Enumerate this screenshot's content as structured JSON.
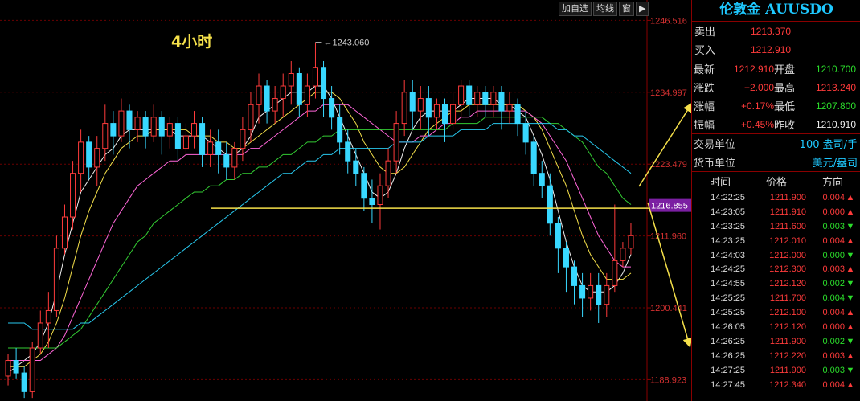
{
  "toolbar": {
    "add_watch": "加自选",
    "ma": "均线",
    "window": "窗",
    "exit_icon": "exit-icon"
  },
  "chart_data": {
    "type": "candlestick",
    "title": "4小时",
    "ylim": [
      1185.5,
      1248.5
    ],
    "y_ticks": [
      "1246.516",
      "1234.997",
      "1223.479",
      "1211.960",
      "1200.441",
      "1188.923"
    ],
    "high_annotation": "1243.060",
    "current_price_label": "1216.855",
    "support_level": 1216.4,
    "grid": "dashed-horizontal",
    "candles": [
      [
        1189.5,
        1192,
        1188,
        1193
      ],
      [
        1192,
        1190,
        1189,
        1194
      ],
      [
        1190,
        1187,
        1186,
        1191
      ],
      [
        1187,
        1194,
        1186,
        1195
      ],
      [
        1194,
        1198,
        1193,
        1200
      ],
      [
        1198,
        1200,
        1194,
        1203
      ],
      [
        1200,
        1210,
        1199,
        1212
      ],
      [
        1210,
        1215,
        1209,
        1217
      ],
      [
        1215,
        1222,
        1213,
        1224
      ],
      [
        1222,
        1227,
        1219,
        1229
      ],
      [
        1227,
        1223,
        1221,
        1228
      ],
      [
        1223,
        1226,
        1220,
        1228
      ],
      [
        1226,
        1230,
        1224,
        1233
      ],
      [
        1230,
        1228,
        1225,
        1232
      ],
      [
        1228,
        1232,
        1227,
        1234
      ],
      [
        1232,
        1229,
        1226,
        1233
      ],
      [
        1229,
        1231,
        1227,
        1232
      ],
      [
        1231,
        1228,
        1226,
        1232
      ],
      [
        1228,
        1231,
        1227,
        1233
      ],
      [
        1231,
        1228,
        1225,
        1232
      ],
      [
        1228,
        1230,
        1226,
        1231
      ],
      [
        1230,
        1226,
        1224,
        1231
      ],
      [
        1226,
        1228,
        1225,
        1230
      ],
      [
        1228,
        1230,
        1226,
        1232
      ],
      [
        1230,
        1225,
        1223,
        1231
      ],
      [
        1225,
        1227,
        1223,
        1229
      ],
      [
        1227,
        1225,
        1222,
        1229
      ],
      [
        1225,
        1223,
        1221,
        1227
      ],
      [
        1223,
        1226,
        1221,
        1227
      ],
      [
        1226,
        1229,
        1224,
        1231
      ],
      [
        1229,
        1233,
        1227,
        1235
      ],
      [
        1233,
        1236,
        1230,
        1238
      ],
      [
        1236,
        1232,
        1230,
        1237
      ],
      [
        1232,
        1234,
        1230,
        1236
      ],
      [
        1234,
        1236,
        1231,
        1238
      ],
      [
        1236,
        1238,
        1233,
        1240
      ],
      [
        1238,
        1233,
        1231,
        1239
      ],
      [
        1233,
        1236,
        1231,
        1238
      ],
      [
        1236,
        1239,
        1234,
        1243
      ],
      [
        1239,
        1234,
        1231,
        1240
      ],
      [
        1234,
        1231,
        1229,
        1236
      ],
      [
        1231,
        1227,
        1225,
        1233
      ],
      [
        1227,
        1224,
        1222,
        1229
      ],
      [
        1224,
        1222,
        1220,
        1226
      ],
      [
        1222,
        1218,
        1216,
        1223
      ],
      [
        1218,
        1217,
        1214,
        1221
      ],
      [
        1217,
        1220,
        1213,
        1222
      ],
      [
        1220,
        1224,
        1218,
        1226
      ],
      [
        1224,
        1230,
        1222,
        1232
      ],
      [
        1230,
        1235,
        1228,
        1237
      ],
      [
        1235,
        1232,
        1229,
        1237
      ],
      [
        1232,
        1234,
        1229,
        1236
      ],
      [
        1234,
        1231,
        1228,
        1236
      ],
      [
        1231,
        1233,
        1229,
        1234
      ],
      [
        1233,
        1230,
        1227,
        1234
      ],
      [
        1230,
        1233,
        1229,
        1235
      ],
      [
        1233,
        1236,
        1231,
        1237
      ],
      [
        1236,
        1233,
        1231,
        1237
      ],
      [
        1233,
        1235,
        1231,
        1236
      ],
      [
        1235,
        1233,
        1231,
        1236
      ],
      [
        1233,
        1235,
        1231,
        1236
      ],
      [
        1235,
        1232,
        1229,
        1236
      ],
      [
        1232,
        1233,
        1230,
        1235
      ],
      [
        1233,
        1230,
        1228,
        1234
      ],
      [
        1230,
        1227,
        1225,
        1232
      ],
      [
        1227,
        1222,
        1220,
        1228
      ],
      [
        1222,
        1220,
        1218,
        1224
      ],
      [
        1220,
        1214,
        1212,
        1222
      ],
      [
        1214,
        1210,
        1206,
        1215
      ],
      [
        1210,
        1207,
        1203,
        1211
      ],
      [
        1207,
        1204,
        1201,
        1208
      ],
      [
        1204,
        1202,
        1199,
        1206
      ],
      [
        1202,
        1204,
        1200,
        1206
      ],
      [
        1204,
        1201,
        1198,
        1206
      ],
      [
        1201,
        1204,
        1199,
        1206
      ],
      [
        1204,
        1208,
        1203,
        1217
      ],
      [
        1208,
        1210,
        1207,
        1211
      ],
      [
        1210,
        1212,
        1209,
        1214
      ]
    ],
    "ma_lines": {
      "ma_white": [
        1190,
        1191,
        1192,
        1193,
        1195,
        1198,
        1203,
        1209,
        1214,
        1219,
        1221,
        1223,
        1225,
        1226,
        1228,
        1229,
        1229,
        1229,
        1229,
        1229,
        1229,
        1228,
        1228,
        1228,
        1228,
        1227,
        1226,
        1225,
        1225,
        1226,
        1228,
        1231,
        1232,
        1233,
        1234,
        1235,
        1235,
        1235,
        1236,
        1236,
        1234,
        1231,
        1228,
        1225,
        1222,
        1219,
        1218,
        1219,
        1222,
        1226,
        1229,
        1231,
        1232,
        1232,
        1232,
        1232,
        1233,
        1234,
        1234,
        1234,
        1234,
        1233,
        1233,
        1232,
        1231,
        1228,
        1225,
        1221,
        1216,
        1211,
        1207,
        1204,
        1203,
        1203,
        1203,
        1204,
        1206,
        1209
      ],
      "ma_yellow": [
        1191,
        1191,
        1191,
        1192,
        1193,
        1195,
        1198,
        1202,
        1207,
        1212,
        1216,
        1219,
        1222,
        1224,
        1226,
        1227,
        1228,
        1228,
        1229,
        1229,
        1229,
        1229,
        1229,
        1228,
        1228,
        1228,
        1227,
        1227,
        1226,
        1226,
        1227,
        1228,
        1229,
        1230,
        1231,
        1232,
        1233,
        1234,
        1235,
        1235,
        1235,
        1234,
        1232,
        1230,
        1227,
        1225,
        1223,
        1222,
        1222,
        1223,
        1225,
        1227,
        1229,
        1230,
        1231,
        1232,
        1232,
        1233,
        1233,
        1233,
        1233,
        1233,
        1233,
        1233,
        1232,
        1231,
        1229,
        1226,
        1223,
        1220,
        1216,
        1212,
        1209,
        1207,
        1205,
        1205,
        1205,
        1206
      ],
      "ma_pink": [
        1192,
        1192,
        1192,
        1192,
        1192,
        1193,
        1194,
        1196,
        1199,
        1202,
        1205,
        1208,
        1211,
        1214,
        1216,
        1218,
        1220,
        1221,
        1222,
        1223,
        1224,
        1224,
        1225,
        1225,
        1225,
        1225,
        1225,
        1225,
        1225,
        1225,
        1226,
        1226,
        1227,
        1228,
        1229,
        1230,
        1231,
        1232,
        1232,
        1233,
        1233,
        1233,
        1233,
        1232,
        1231,
        1230,
        1229,
        1228,
        1227,
        1227,
        1227,
        1228,
        1228,
        1229,
        1230,
        1230,
        1231,
        1231,
        1232,
        1232,
        1232,
        1232,
        1232,
        1232,
        1232,
        1231,
        1230,
        1228,
        1226,
        1224,
        1221,
        1218,
        1215,
        1212,
        1210,
        1208,
        1207,
        1207
      ],
      "ma_green": [
        1194,
        1194,
        1194,
        1194,
        1194,
        1194,
        1194,
        1195,
        1196,
        1197,
        1199,
        1201,
        1203,
        1205,
        1207,
        1209,
        1211,
        1212,
        1214,
        1215,
        1216,
        1217,
        1218,
        1219,
        1219,
        1220,
        1220,
        1221,
        1221,
        1222,
        1222,
        1223,
        1223,
        1224,
        1225,
        1225,
        1226,
        1227,
        1227,
        1228,
        1228,
        1229,
        1229,
        1229,
        1229,
        1229,
        1229,
        1229,
        1229,
        1229,
        1229,
        1229,
        1229,
        1229,
        1229,
        1230,
        1230,
        1230,
        1230,
        1231,
        1231,
        1231,
        1231,
        1231,
        1231,
        1231,
        1231,
        1230,
        1230,
        1229,
        1228,
        1227,
        1225,
        1223,
        1222,
        1220,
        1218,
        1217
      ],
      "ma_cyan": [
        1198,
        1198,
        1198,
        1197,
        1197,
        1197,
        1197,
        1197,
        1197,
        1198,
        1198,
        1199,
        1200,
        1201,
        1202,
        1203,
        1204,
        1205,
        1206,
        1207,
        1208,
        1209,
        1210,
        1211,
        1212,
        1213,
        1214,
        1215,
        1216,
        1217,
        1218,
        1219,
        1220,
        1221,
        1222,
        1222,
        1223,
        1224,
        1224,
        1225,
        1225,
        1226,
        1226,
        1226,
        1226,
        1226,
        1226,
        1226,
        1227,
        1227,
        1227,
        1227,
        1228,
        1228,
        1228,
        1228,
        1229,
        1229,
        1229,
        1229,
        1230,
        1230,
        1230,
        1230,
        1230,
        1230,
        1230,
        1230,
        1229,
        1229,
        1228,
        1228,
        1227,
        1226,
        1225,
        1224,
        1223,
        1222
      ]
    }
  },
  "panel": {
    "title": "伦敦金 AUUSDO",
    "sell_label": "卖出",
    "sell_value": "1213.370",
    "buy_label": "买入",
    "buy_value": "1212.910",
    "latest_label": "最新",
    "latest_value": "1212.910",
    "open_label": "开盘",
    "open_value": "1210.700",
    "change_label": "涨跌",
    "change_value": "+2.000",
    "high_label": "最高",
    "high_value": "1213.240",
    "pct_label": "涨幅",
    "pct_value": "+0.17%",
    "low_label": "最低",
    "low_value": "1207.800",
    "amp_label": "振幅",
    "amp_value": "+0.45%",
    "prev_label": "昨收",
    "prev_value": "1210.910",
    "trade_unit_label": "交易单位",
    "trade_unit_value": "100 盎司/手",
    "currency_label": "货币单位",
    "currency_value": "美元/盎司",
    "col_time": "时间",
    "col_price": "价格",
    "col_dir": "方向",
    "trades": [
      {
        "time": "14:22:25",
        "price": "1211.900",
        "qty": "0.004",
        "dir": "up"
      },
      {
        "time": "14:23:05",
        "price": "1211.910",
        "qty": "0.000",
        "dir": "up"
      },
      {
        "time": "14:23:25",
        "price": "1211.600",
        "qty": "0.003",
        "dir": "down"
      },
      {
        "time": "14:23:25",
        "price": "1212.010",
        "qty": "0.004",
        "dir": "up"
      },
      {
        "time": "14:24:03",
        "price": "1212.000",
        "qty": "0.000",
        "dir": "down"
      },
      {
        "time": "14:24:25",
        "price": "1212.300",
        "qty": "0.003",
        "dir": "up"
      },
      {
        "time": "14:24:55",
        "price": "1212.120",
        "qty": "0.002",
        "dir": "down"
      },
      {
        "time": "14:25:25",
        "price": "1211.700",
        "qty": "0.004",
        "dir": "down"
      },
      {
        "time": "14:25:25",
        "price": "1212.100",
        "qty": "0.004",
        "dir": "up"
      },
      {
        "time": "14:26:05",
        "price": "1212.120",
        "qty": "0.000",
        "dir": "up"
      },
      {
        "time": "14:26:25",
        "price": "1211.900",
        "qty": "0.002",
        "dir": "down"
      },
      {
        "time": "14:26:25",
        "price": "1212.220",
        "qty": "0.003",
        "dir": "up"
      },
      {
        "time": "14:27:25",
        "price": "1211.900",
        "qty": "0.003",
        "dir": "down"
      },
      {
        "time": "14:27:45",
        "price": "1212.340",
        "qty": "0.004",
        "dir": "up"
      }
    ]
  }
}
